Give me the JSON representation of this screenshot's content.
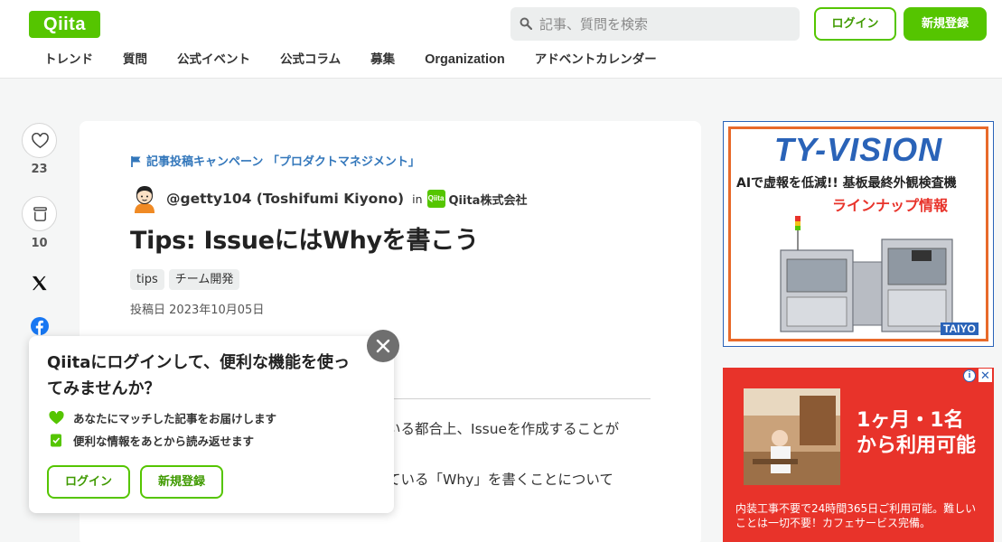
{
  "header": {
    "logo": "Qiita",
    "search_placeholder": "記事、質問を検索",
    "login_label": "ログイン",
    "signup_label": "新規登録",
    "nav": [
      "トレンド",
      "質問",
      "公式イベント",
      "公式コラム",
      "募集",
      "Organization",
      "アドベントカレンダー"
    ]
  },
  "rail": {
    "likes": "23",
    "stocks": "10"
  },
  "article": {
    "campaign": "記事投稿キャンペーン 「プロダクトマネジメント」",
    "author": "@getty104 (Toshifumi Kiyono)",
    "in_label": "in",
    "org_icon": "Qiita",
    "org_name": "Qiita株式会社",
    "title": "Tips: IssueにはWhyを書こう",
    "tags": [
      "tips",
      "チーム開発"
    ],
    "posted_label": "投稿日",
    "posted_date": "2023年10月05日",
    "body_fragment_1": "いる都合上、Issueを作成することが",
    "body_fragment_2": "ている「Why」を書くことについて"
  },
  "popup": {
    "title": "Qiitaにログインして、便利な機能を使ってみませんか？",
    "features": [
      "あなたにマッチした記事をお届けします",
      "便利な情報をあとから読み返せます"
    ],
    "login_label": "ログイン",
    "signup_label": "新規登録"
  },
  "ads": {
    "ad1": {
      "brand": "TY-VISION",
      "line1": "AIで虚報を低減!! 基板最終外観検査機",
      "line2": "ラインナップ情報",
      "logo": "TAIYO"
    },
    "ad2": {
      "headline": "1ヶ月・1名から利用可能",
      "body": "内装工事不要で24時間365日ご利用可能。難しいことは一切不要！カフェサービス完備。"
    }
  },
  "colors": {
    "brand": "#55c500",
    "link": "#3377bb",
    "ad_red": "#e8332a",
    "ad_blue": "#2a63b8"
  },
  "icons": [
    "search-icon",
    "heart-icon",
    "stock-icon",
    "x-icon",
    "facebook-icon",
    "hatena-icon",
    "more-icon",
    "flag-icon",
    "close-icon",
    "heart-check-icon",
    "check-icon"
  ]
}
